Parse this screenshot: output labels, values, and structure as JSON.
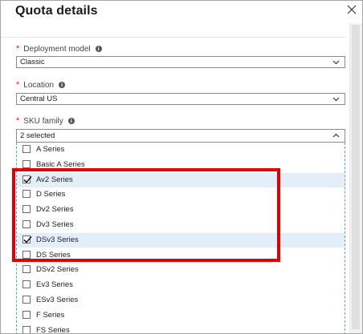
{
  "panel": {
    "title": "Quota details"
  },
  "deployment_model": {
    "label": "Deployment model",
    "value": "Classic"
  },
  "location": {
    "label": "Location",
    "value": "Central US"
  },
  "sku_family": {
    "label": "SKU family",
    "value": "2 selected",
    "options": [
      {
        "label": "A Series",
        "checked": false
      },
      {
        "label": "Basic A Series",
        "checked": false
      },
      {
        "label": "Av2 Series",
        "checked": true
      },
      {
        "label": "D Series",
        "checked": false
      },
      {
        "label": "Dv2 Series",
        "checked": false
      },
      {
        "label": "Dv3 Series",
        "checked": false
      },
      {
        "label": "DSv3 Series",
        "checked": true
      },
      {
        "label": "DS Series",
        "checked": false
      },
      {
        "label": "DSv2 Series",
        "checked": false
      },
      {
        "label": "Ev3 Series",
        "checked": false
      },
      {
        "label": "ESv3 Series",
        "checked": false
      },
      {
        "label": "F Series",
        "checked": false
      },
      {
        "label": "FS Series",
        "checked": false
      }
    ]
  },
  "colors": {
    "highlight": "#e00000",
    "selected_row": "#e3eef8",
    "required": "#e81123"
  },
  "icons": [
    "close-icon",
    "info-icon",
    "chevron-down-icon",
    "chevron-up-icon",
    "checkmark-icon"
  ]
}
